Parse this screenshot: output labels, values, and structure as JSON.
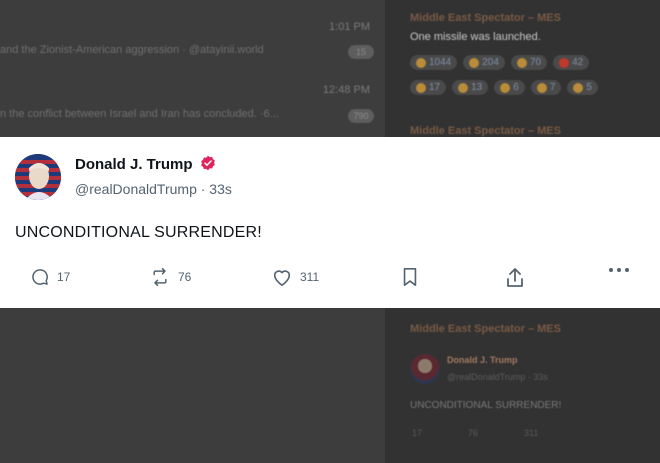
{
  "background": {
    "left_panel": {
      "messages": [
        {
          "time": "1:01 PM",
          "preview": "and the Zionist-American aggression · @atayinii.world",
          "badge": "15"
        },
        {
          "time": "12:48 PM",
          "preview": "n the conflict between Israel and Iran has concluded. ·6...",
          "badge": "790"
        }
      ]
    },
    "right_panel": {
      "post1": {
        "sender": "Middle East Spectator – MES",
        "text": "One missile was launched.",
        "reactions_row1": [
          "1044",
          "204",
          "70",
          "42"
        ],
        "reactions_row2": [
          "17",
          "13",
          "6",
          "7",
          "5"
        ]
      },
      "post2": {
        "sender": "Middle East Spectator – MES"
      },
      "post3": {
        "sender": "Middle East Spectator – MES",
        "mini_name": "Donald J. Trump",
        "mini_handle": "@realDonaldTrump · 33s",
        "mini_text": "UNCONDITIONAL SURRENDER!",
        "mini_counts": [
          "17",
          "76",
          "311"
        ]
      }
    }
  },
  "tweet": {
    "display_name": "Donald J. Trump",
    "handle_and_time": "@realDonaldTrump · 33s",
    "text": "UNCONDITIONAL SURRENDER!",
    "replies": "17",
    "retweets": "76",
    "likes": "311",
    "icons": {
      "verified": "verified-badge-icon",
      "reply": "reply-icon",
      "retweet": "retweet-icon",
      "like": "heart-icon",
      "bookmark": "bookmark-icon",
      "share": "share-icon",
      "more": "more-icon"
    },
    "colors": {
      "verified": "#e0245e",
      "text": "#0f1419",
      "muted": "#536471"
    }
  }
}
